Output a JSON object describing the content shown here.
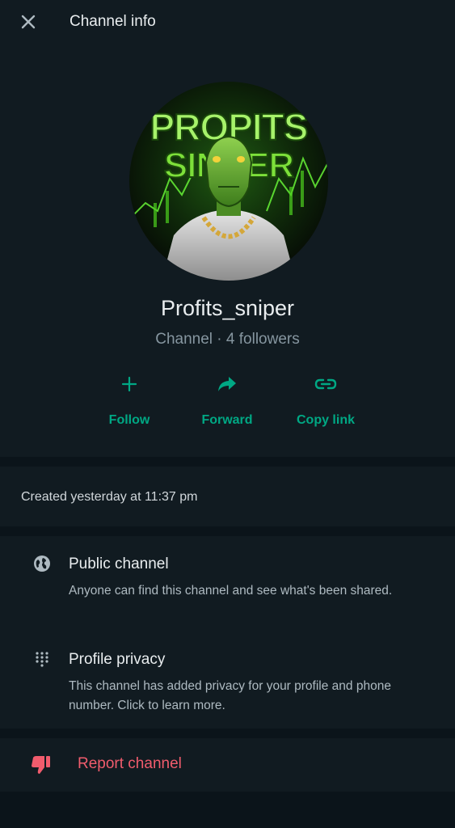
{
  "header": {
    "title": "Channel info",
    "close_icon": "close-icon"
  },
  "profile": {
    "avatar_text_line1": "PROPITS",
    "avatar_text_line2": "SINKER",
    "name": "Profits_sniper",
    "meta": "Channel · 4 followers"
  },
  "actions": [
    {
      "label": "Follow",
      "icon": "plus-icon"
    },
    {
      "label": "Forward",
      "icon": "forward-arrow-icon"
    },
    {
      "label": "Copy link",
      "icon": "link-icon"
    }
  ],
  "created": "Created yesterday at 11:37 pm",
  "info": [
    {
      "title": "Public channel",
      "description": "Anyone can find this channel and see what's been shared.",
      "icon": "globe-icon"
    },
    {
      "title": "Profile privacy",
      "description": "This channel has added privacy for your profile and phone number. Click to learn more.",
      "icon": "dotted-grid-icon"
    }
  ],
  "report": {
    "label": "Report channel",
    "icon": "thumbs-down-icon"
  },
  "colors": {
    "background": "#0b141a",
    "panel": "#111b21",
    "accent": "#00a884",
    "danger": "#f15c6d",
    "muted": "#8696a0"
  }
}
